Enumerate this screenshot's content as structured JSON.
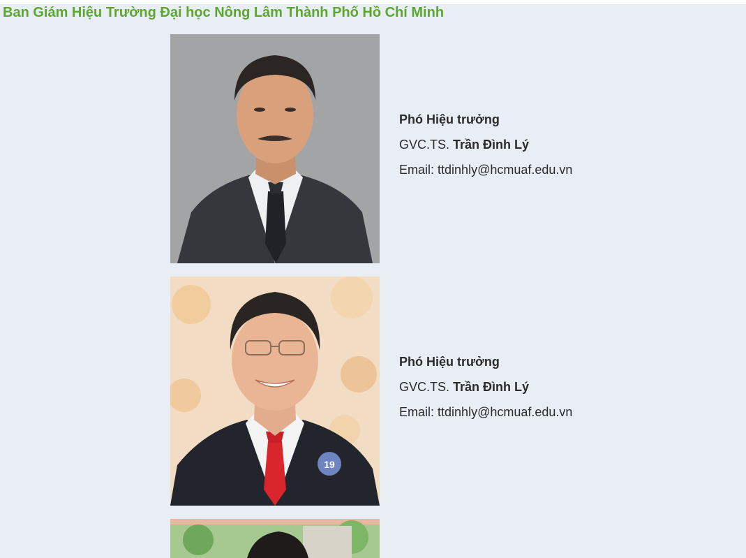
{
  "page": {
    "title": "Ban Giám Hiệu Trường Đại học Nông Lâm Thành Phố Hồ Chí Minh"
  },
  "members": [
    {
      "role": "Phó Hiệu trưởng",
      "degree": "GVC.TS.",
      "name": "Trần Đình Lý",
      "email_label": "Email:",
      "email": "ttdinhly@hcmuaf.edu.vn"
    },
    {
      "role": "Phó Hiệu trưởng",
      "degree": "GVC.TS.",
      "name": "Trần Đình Lý",
      "email_label": "Email:",
      "email": "ttdinhly@hcmuaf.edu.vn"
    }
  ],
  "colors": {
    "title": "#5ba72f",
    "background": "#e9eef5",
    "text": "#2b2b2b"
  }
}
